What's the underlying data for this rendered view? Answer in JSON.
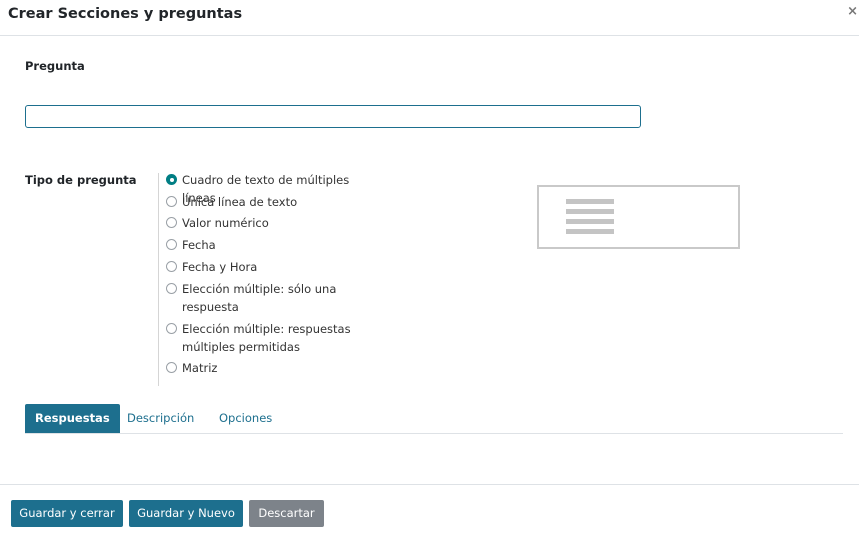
{
  "dialog": {
    "title": "Crear Secciones y preguntas",
    "close_icon": "×"
  },
  "form": {
    "question_label": "Pregunta",
    "question_value": "",
    "type_label": "Tipo de pregunta",
    "question_types": [
      {
        "label": "Cuadro de texto de múltiples líneas",
        "checked": true
      },
      {
        "label": "Única línea de texto",
        "checked": false
      },
      {
        "label": "Valor numérico",
        "checked": false
      },
      {
        "label": "Fecha",
        "checked": false
      },
      {
        "label": "Fecha y Hora",
        "checked": false
      },
      {
        "label": "Elección múltiple: sólo una respuesta",
        "checked": false
      },
      {
        "label": "Elección múltiple: respuestas múltiples permitidas",
        "checked": false
      },
      {
        "label": "Matriz",
        "checked": false
      }
    ]
  },
  "tabs": [
    {
      "label": "Respuestas",
      "active": true
    },
    {
      "label": "Descripción",
      "active": false
    },
    {
      "label": "Opciones",
      "active": false
    }
  ],
  "footer": {
    "save_close": "Guardar y cerrar",
    "save_new": "Guardar y Nuevo",
    "discard": "Descartar"
  },
  "colors": {
    "primary": "#1d6f8e",
    "radio_checked": "#017e84",
    "discard": "#7d838a"
  }
}
